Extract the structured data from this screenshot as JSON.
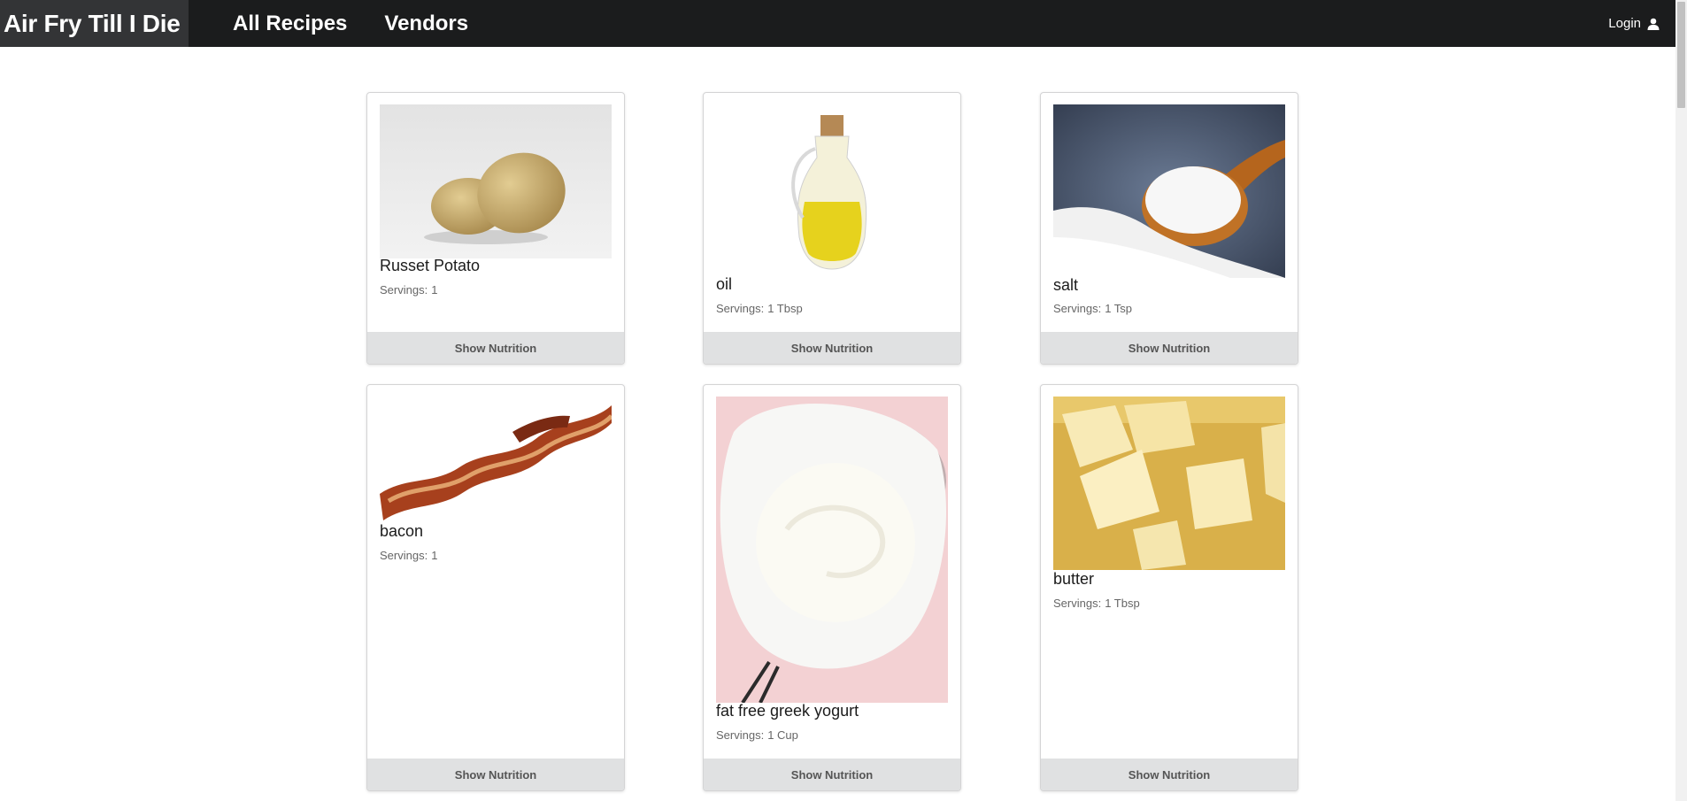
{
  "nav": {
    "brand": "Air Fry Till I Die",
    "links": [
      "All Recipes",
      "Vendors"
    ],
    "login": "Login"
  },
  "cards": [
    {
      "name": "Russet Potato",
      "servings_label": "Servings:",
      "servings": "1",
      "button": "Show Nutrition",
      "image_icon": "potato-image"
    },
    {
      "name": "oil",
      "servings_label": "Servings:",
      "servings": "1 Tbsp",
      "button": "Show Nutrition",
      "image_icon": "oil-bottle-image"
    },
    {
      "name": "salt",
      "servings_label": "Servings:",
      "servings": "1 Tsp",
      "button": "Show Nutrition",
      "image_icon": "salt-spoon-image"
    },
    {
      "name": "bacon",
      "servings_label": "Servings:",
      "servings": "1",
      "button": "Show Nutrition",
      "image_icon": "bacon-image"
    },
    {
      "name": "fat free greek yogurt",
      "servings_label": "Servings:",
      "servings": "1 Cup",
      "button": "Show Nutrition",
      "image_icon": "yogurt-strainer-image"
    },
    {
      "name": "butter",
      "servings_label": "Servings:",
      "servings": "1 Tbsp",
      "button": "Show Nutrition",
      "image_icon": "butter-image"
    }
  ],
  "colors": {
    "navbar": "#1b1c1d",
    "brand_bg": "#333436",
    "button_bg": "#e0e1e2",
    "card_border": "#d4d4d5"
  }
}
